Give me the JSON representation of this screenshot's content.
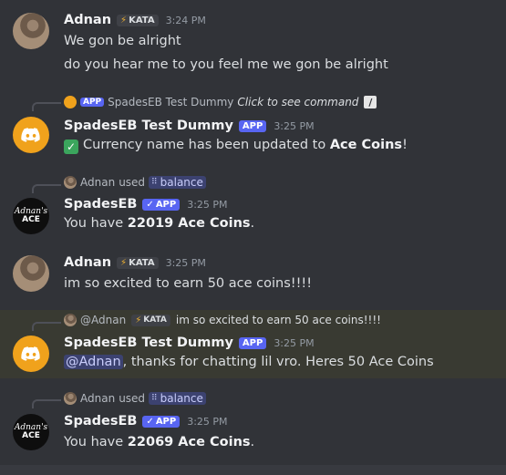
{
  "messages": {
    "m1": {
      "author": "Adnan",
      "tag": "KATA",
      "time": "3:24 PM",
      "line1": "We gon be alright",
      "line2": "do you hear me to you feel me we gon be alright"
    },
    "m2": {
      "reply_app": "APP",
      "reply_name": "SpadesEB Test Dummy",
      "reply_cmd": "Click to see command",
      "author": "SpadesEB Test Dummy",
      "badge": "APP",
      "time": "3:25 PM",
      "text_pre": "Currency name has been updated to ",
      "text_bold": "Ace Coins",
      "text_post": "!"
    },
    "m3": {
      "reply_user": "Adnan",
      "reply_used": "used",
      "reply_cmd": "balance",
      "author": "SpadesEB",
      "badge": "APP",
      "time": "3:25 PM",
      "text_pre": "You have ",
      "text_bold": "22019 Ace Coins",
      "text_post": "."
    },
    "m4": {
      "author": "Adnan",
      "tag": "KATA",
      "time": "3:25 PM",
      "line1": "im so excited to earn 50 ace coins!!!!"
    },
    "m5": {
      "reply_user": "@Adnan",
      "reply_tag": "KATA",
      "reply_text": "im so excited to earn 50 ace coins!!!!",
      "author": "SpadesEB Test Dummy",
      "badge": "APP",
      "time": "3:25 PM",
      "mention": "@Adnan",
      "text": ", thanks for chatting lil vro. Heres 50 Ace Coins"
    },
    "m6": {
      "reply_user": "Adnan",
      "reply_used": "used",
      "reply_cmd": "balance",
      "author": "SpadesEB",
      "badge": "APP",
      "time": "3:25 PM",
      "text_pre": "You have ",
      "text_bold": "22069 Ace Coins",
      "text_post": "."
    }
  },
  "avatar_text": {
    "line1": "Adnan's",
    "line2": "ACE"
  },
  "icons": {
    "bolt": "⚡",
    "check": "✓",
    "verified": "✓",
    "slash": "/",
    "grid": "⠿"
  },
  "colors": {
    "background": "#313338",
    "highlight": "#393a32",
    "app_badge": "#5865f2",
    "bot_avatar": "#f0a21c",
    "mention_bg": "#3c4270"
  }
}
